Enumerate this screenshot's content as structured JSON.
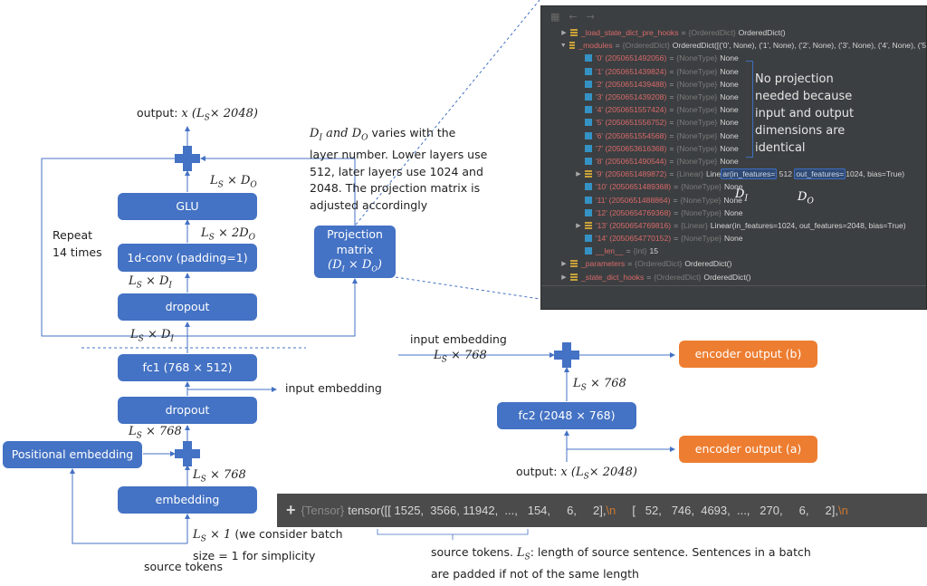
{
  "encoder_block": {
    "output_label_prefix": "output: ",
    "output_label_math": "x (L",
    "output_sub": "S",
    "output_dim": "× 2048)",
    "glu": "GLU",
    "conv": "1d-conv (padding=1)",
    "dropout_top": "dropout",
    "fc1": "fc1 (768 × 512)",
    "dropout_bottom": "dropout",
    "embedding": "embedding",
    "positional_embedding": "Positional embedding",
    "projection": [
      "Projection",
      "matrix",
      "(D_I × D_O)"
    ],
    "repeat": [
      "Repeat",
      "14 times"
    ],
    "input_embedding_tap": "input embedding",
    "source_tokens": "source tokens",
    "batch_note": [
      "(we consider batch",
      "size = 1 for simplicity"
    ]
  },
  "shape_labels": {
    "ls_do": "L_S × D_O",
    "ls_2do": "L_S × 2D_O",
    "ls_di": "L_S × D_I",
    "ls_768": "L_S × 768",
    "ls_1": "L_S × 1"
  },
  "projection_note": {
    "math": "D_I and D_O",
    "lines": [
      "varies with the",
      "layer number. Lower layers use",
      "512, later layers use 1024 and",
      "2048. The projection matrix is",
      "adjusted accordingly"
    ]
  },
  "decoder_side": {
    "input_embedding": "input embedding",
    "fc2": "fc2 (2048 × 768)",
    "encoder_output_b": "encoder output (b)",
    "encoder_output_a": "encoder output (a)",
    "output_label": "output: x (L_S× 2048)"
  },
  "debugger": {
    "rows": [
      {
        "expand": "right",
        "icon": "list",
        "name": "_load_state_dict_pre_hooks",
        "type": "{OrderedDict}",
        "value": "OrderedDict()",
        "indent": 0
      },
      {
        "expand": "down",
        "icon": "list",
        "name": "_modules",
        "type": "{OrderedDict}",
        "value": "OrderedDict([('0', None), ('1', None), ('2', None), ('3', None), ('4', None), ('5",
        "indent": 0
      },
      {
        "expand": "",
        "icon": "prim",
        "name": "'0' (2050651492056)",
        "type": "{NoneType}",
        "value": "None",
        "indent": 1
      },
      {
        "expand": "",
        "icon": "prim",
        "name": "'1' (2050651439824)",
        "type": "{NoneType}",
        "value": "None",
        "indent": 1
      },
      {
        "expand": "",
        "icon": "prim",
        "name": "'2' (2050651439488)",
        "type": "{NoneType}",
        "value": "None",
        "indent": 1
      },
      {
        "expand": "",
        "icon": "prim",
        "name": "'3' (2050651439208)",
        "type": "{NoneType}",
        "value": "None",
        "indent": 1
      },
      {
        "expand": "",
        "icon": "prim",
        "name": "'4' (2050651557424)",
        "type": "{NoneType}",
        "value": "None",
        "indent": 1
      },
      {
        "expand": "",
        "icon": "prim",
        "name": "'5' (2050651556752)",
        "type": "{NoneType}",
        "value": "None",
        "indent": 1
      },
      {
        "expand": "",
        "icon": "prim",
        "name": "'6' (2050651554568)",
        "type": "{NoneType}",
        "value": "None",
        "indent": 1
      },
      {
        "expand": "",
        "icon": "prim",
        "name": "'7' (2050653616368)",
        "type": "{NoneType}",
        "value": "None",
        "indent": 1
      },
      {
        "expand": "",
        "icon": "prim",
        "name": "'8' (2050651490544)",
        "type": "{NoneType}",
        "value": "None",
        "indent": 1
      },
      {
        "expand": "right",
        "icon": "list",
        "name": "'9' (2050651489872)",
        "type": "{Linear}",
        "value": "Linear(in_features=512, out_features=1024, bias=True)",
        "indent": 1,
        "highlight": true
      },
      {
        "expand": "",
        "icon": "prim",
        "name": "'10' (2050651489368)",
        "type": "{NoneType}",
        "value": "None",
        "indent": 1
      },
      {
        "expand": "",
        "icon": "prim",
        "name": "'11' (2050651488864)",
        "type": "{NoneType}",
        "value": "None",
        "indent": 1
      },
      {
        "expand": "",
        "icon": "prim",
        "name": "'12' (2050654769368)",
        "type": "{NoneType}",
        "value": "None",
        "indent": 1
      },
      {
        "expand": "right",
        "icon": "list",
        "name": "'13' (2050654769816)",
        "type": "{Linear}",
        "value": "Linear(in_features=1024, out_features=2048, bias=True)",
        "indent": 1
      },
      {
        "expand": "",
        "icon": "prim",
        "name": "'14' (2050654770152)",
        "type": "{NoneType}",
        "value": "None",
        "indent": 1
      },
      {
        "expand": "",
        "icon": "prim",
        "name": "__len__",
        "type": "{int}",
        "value": "15",
        "indent": 1
      },
      {
        "expand": "right",
        "icon": "list",
        "name": "_parameters",
        "type": "{OrderedDict}",
        "value": "OrderedDict()",
        "indent": 0
      },
      {
        "expand": "right",
        "icon": "list",
        "name": "_state_dict_hooks",
        "type": "{OrderedDict}",
        "value": "OrderedDict()",
        "indent": 0
      }
    ],
    "row9_parts": {
      "pre": "Line",
      "h1": "ar(in_features=",
      "mid": " 512 ",
      "h2": "out_features=",
      "post": "1024, bias=True)"
    },
    "note": [
      "No projection",
      "needed because",
      "input and output",
      "dimensions are",
      "identical"
    ],
    "di_label": "D_I",
    "do_label": "D_O"
  },
  "tensor_bar": {
    "type": "{Tensor}",
    "text1": "tensor([[ 1525,  3566, 11942,  ...,   154,     6,     2],",
    "nl1": "\\n",
    "text2": "     [   52,   746,  4693,  ...,   270,     6,     2],",
    "nl2": "\\n"
  },
  "source_note": [
    "source tokens. L_S: length of source sentence. Sentences in a batch",
    "are padded if not of the same length"
  ],
  "colors": {
    "block": "#4472c4",
    "output": "#ed7d31",
    "debugger_bg": "#3c3f41",
    "tensor_bg": "#4b4b4b"
  }
}
